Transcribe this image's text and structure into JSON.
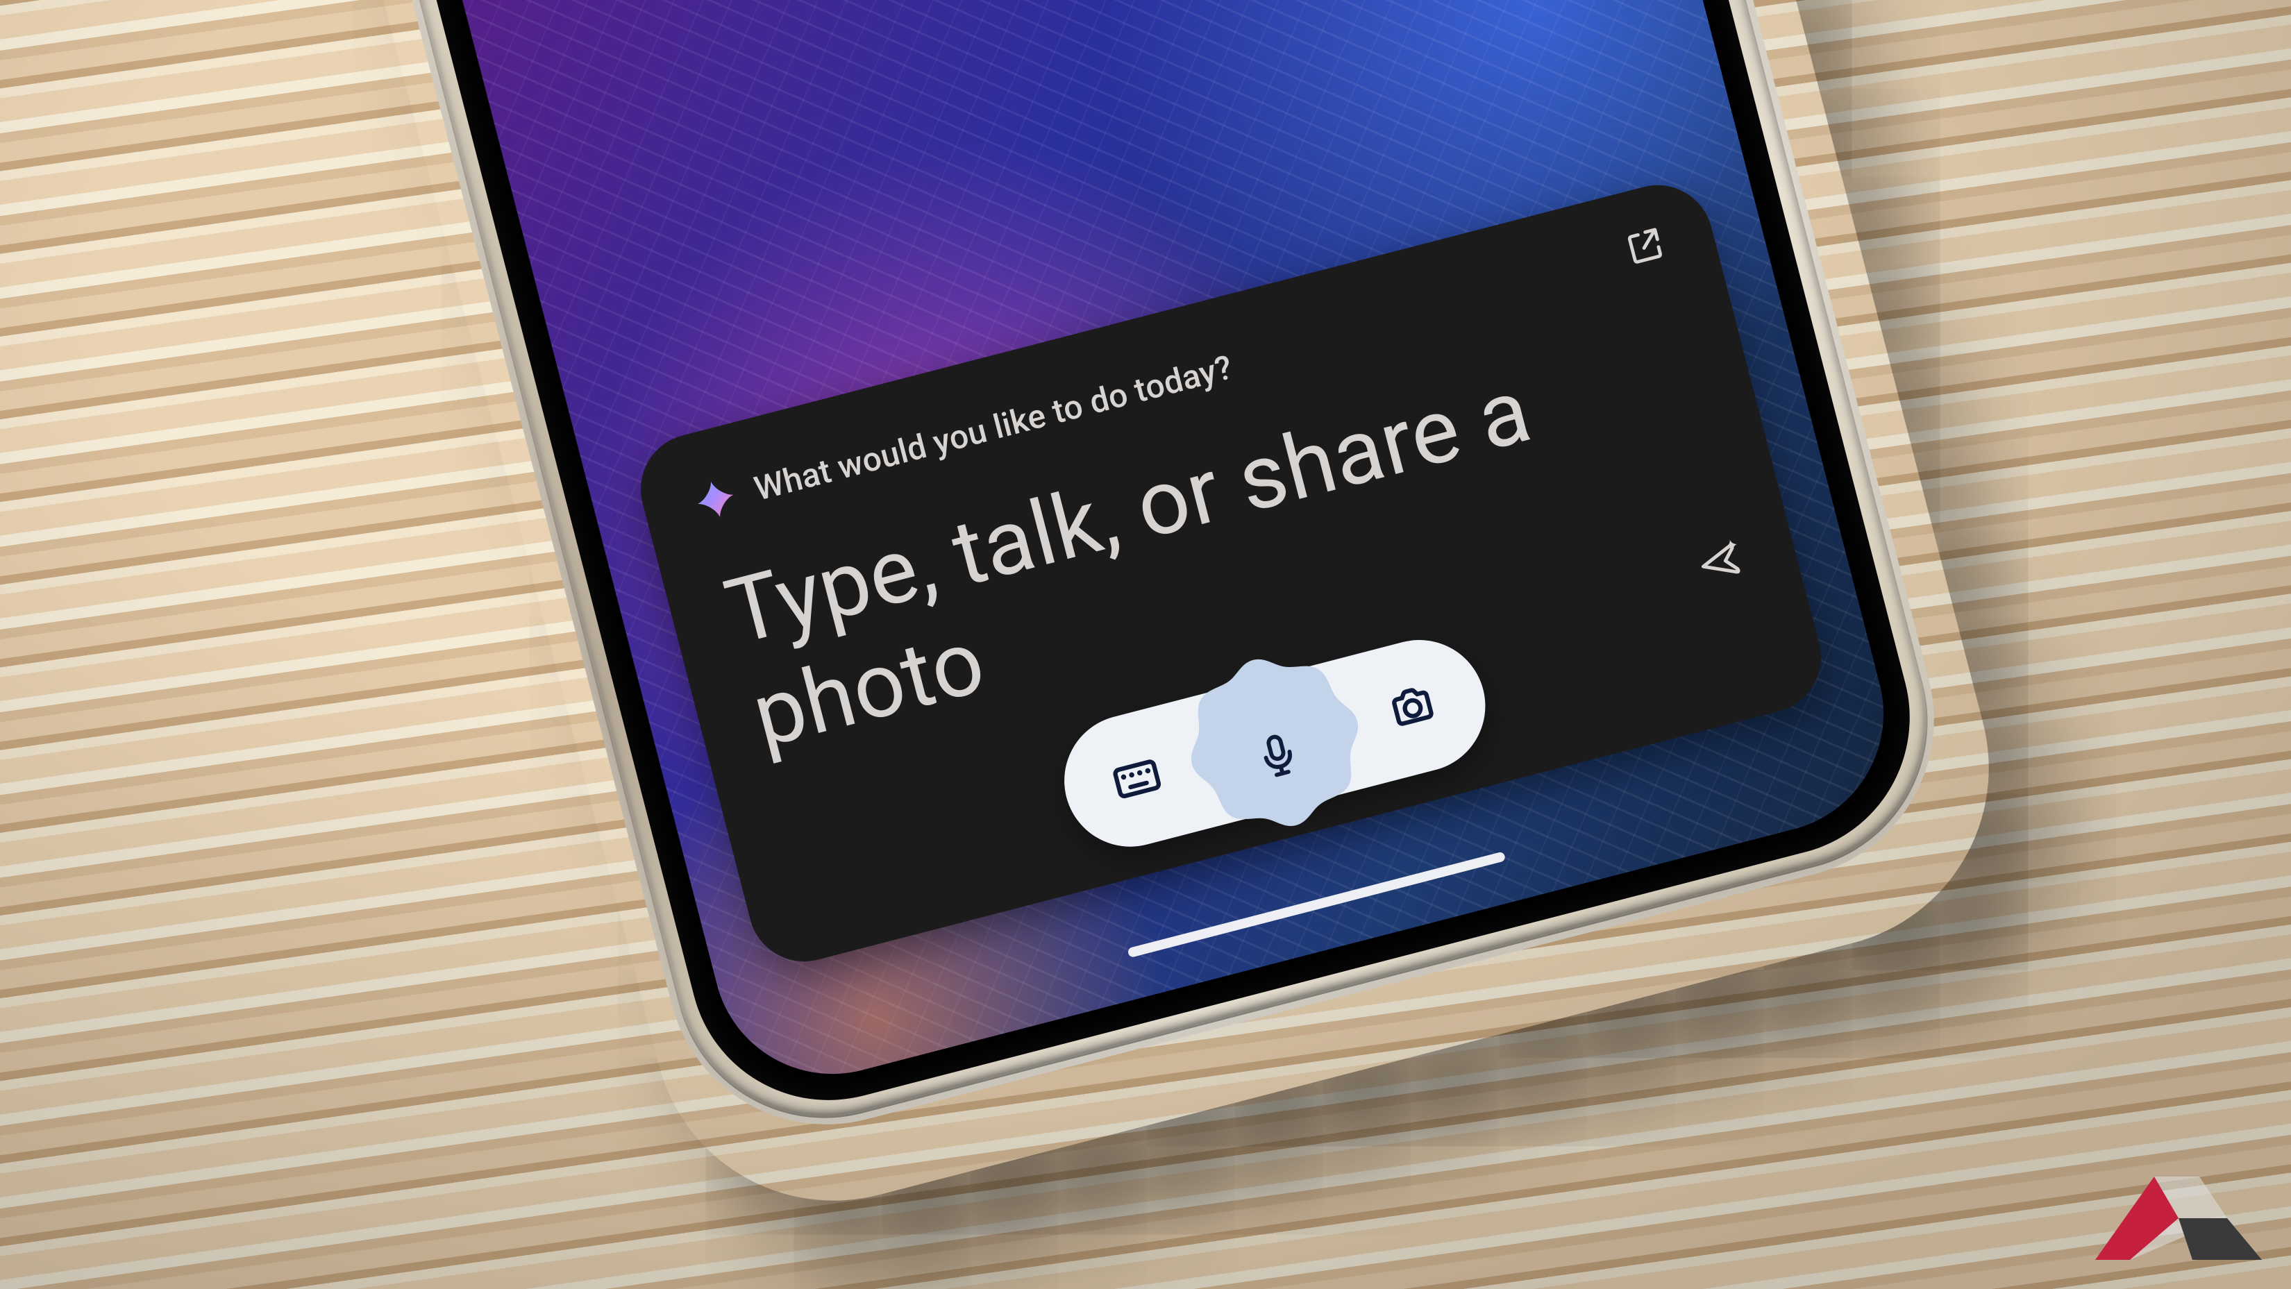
{
  "assistant": {
    "greeting": "What would you like to do today?",
    "placeholder": "Type, talk, or share a photo"
  },
  "icons": {
    "sparkle": "sparkle-icon",
    "open": "open-external-icon",
    "send": "send-sparkle-icon",
    "keyboard": "keyboard-icon",
    "mic": "microphone-icon",
    "camera": "camera-icon"
  },
  "colors": {
    "card_bg": "#1c1b1c",
    "text": "#d7d3d0",
    "pill_bg": "#eef1f6",
    "mic_blob": "#c2d3ea",
    "icon_stroke": "#0e1b3b"
  },
  "watermark": {
    "left_color": "#c6203f",
    "right_color": "#3a3a3a"
  }
}
